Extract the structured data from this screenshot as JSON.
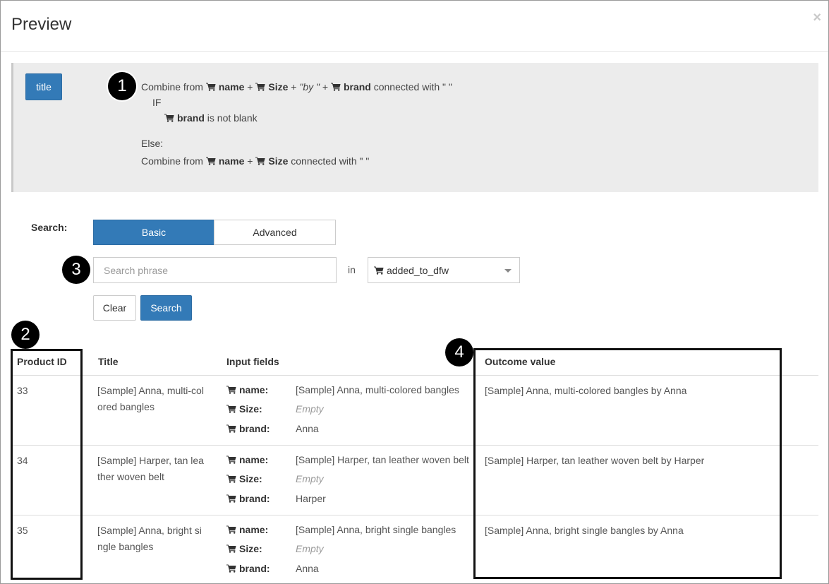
{
  "modal": {
    "title": "Preview",
    "close_label": "×"
  },
  "rule": {
    "field_badge": "title",
    "line1": {
      "prefix": "Combine from",
      "field_a": "name",
      "plus1": "+",
      "field_b": "Size",
      "plus2": "+",
      "literal": "\"by \"",
      "plus3": "+",
      "field_c": "brand",
      "suffix": "connected with \" \""
    },
    "if_label": "IF",
    "condition": {
      "field": "brand",
      "text": "is not blank"
    },
    "else_label": "Else:",
    "else_line": {
      "prefix": "Combine from",
      "field_a": "name",
      "plus1": "+",
      "field_b": "Size",
      "suffix": "connected with \" \""
    }
  },
  "search": {
    "label": "Search:",
    "modes": [
      "Basic",
      "Advanced"
    ],
    "active_mode": "Basic",
    "input_placeholder": "Search phrase",
    "input_value": "",
    "in_label": "in",
    "scope_value": "added_to_dfw",
    "clear_label": "Clear",
    "search_label": "Search"
  },
  "callouts": [
    "1",
    "2",
    "3",
    "4"
  ],
  "table": {
    "columns": [
      "Product ID",
      "Title",
      "Input fields",
      "Outcome value"
    ],
    "rows": [
      {
        "id": "33",
        "title_l1": "[Sample] Anna, multi-col",
        "title_l2": "ored bangles",
        "fields": [
          {
            "key": "name:",
            "value": "[Sample] Anna, multi-colored bangles",
            "empty": false
          },
          {
            "key": "Size:",
            "value": "Empty",
            "empty": true
          },
          {
            "key": "brand:",
            "value": "Anna",
            "empty": false
          }
        ],
        "outcome": "[Sample] Anna, multi-colored bangles by Anna"
      },
      {
        "id": "34",
        "title_l1": "[Sample] Harper, tan lea",
        "title_l2": "ther woven belt",
        "fields": [
          {
            "key": "name:",
            "value": "[Sample] Harper, tan leather woven belt",
            "empty": false
          },
          {
            "key": "Size:",
            "value": "Empty",
            "empty": true
          },
          {
            "key": "brand:",
            "value": "Harper",
            "empty": false
          }
        ],
        "outcome": "[Sample] Harper, tan leather woven belt by Harper"
      },
      {
        "id": "35",
        "title_l1": "[Sample] Anna, bright si",
        "title_l2": "ngle bangles",
        "fields": [
          {
            "key": "name:",
            "value": "[Sample] Anna, bright single bangles",
            "empty": false
          },
          {
            "key": "Size:",
            "value": "Empty",
            "empty": true
          },
          {
            "key": "brand:",
            "value": "Anna",
            "empty": false
          }
        ],
        "outcome": "[Sample] Anna, bright single bangles by Anna"
      }
    ]
  },
  "colors": {
    "primary": "#337ab7",
    "panel_bg": "#ececec",
    "callout": "#000000"
  }
}
